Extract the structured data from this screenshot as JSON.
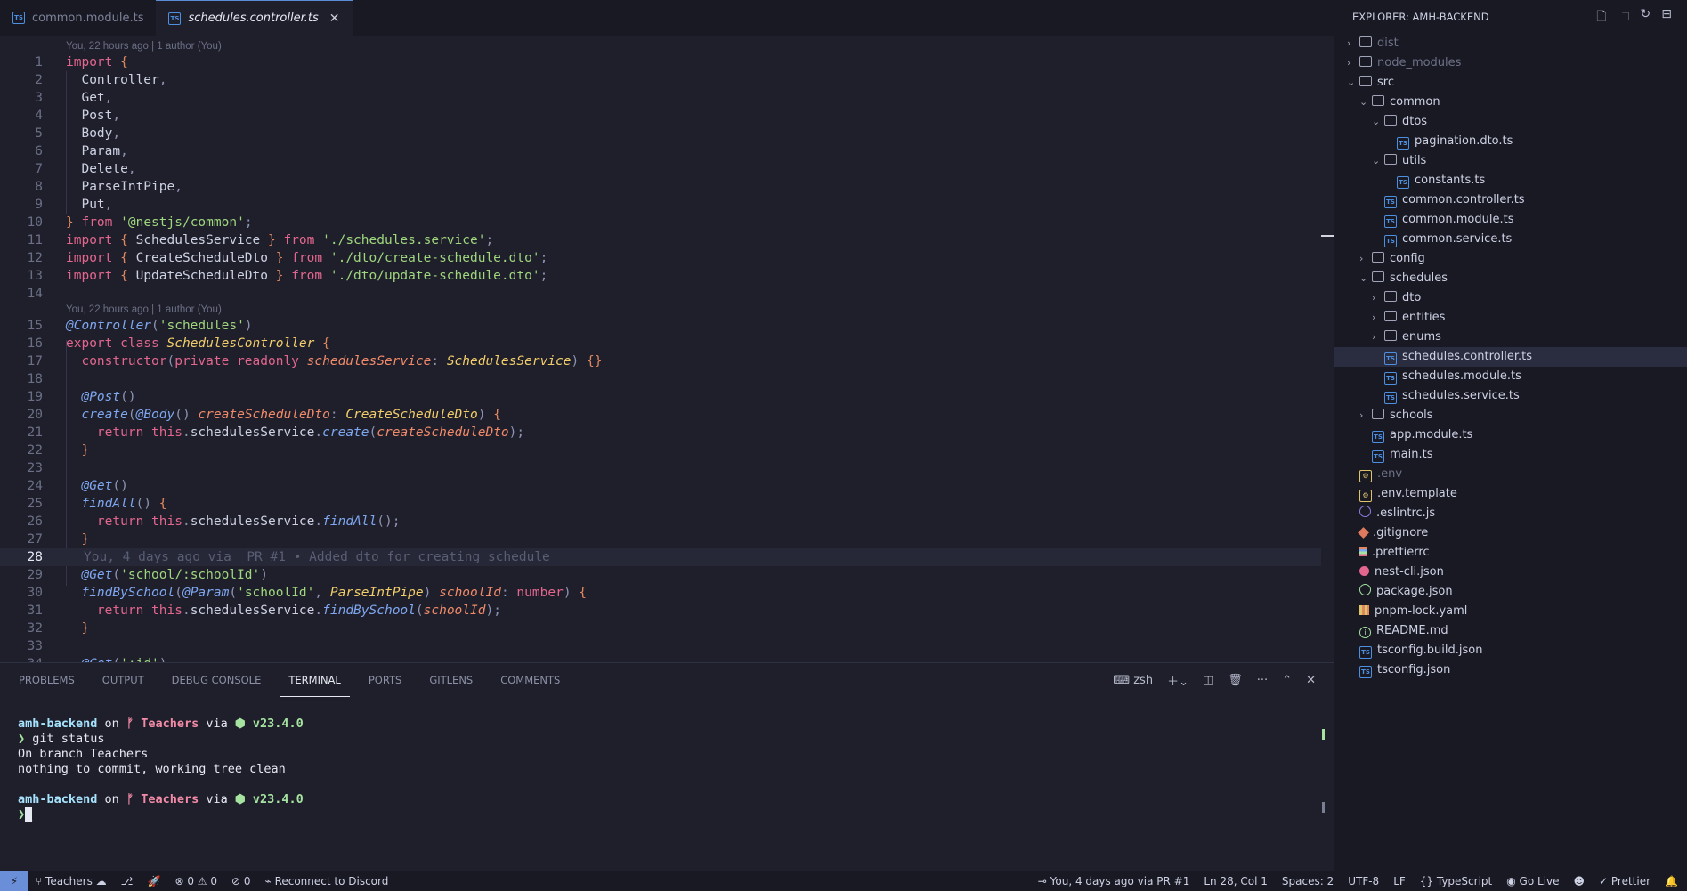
{
  "tabs": [
    {
      "label": "common.module.ts",
      "active": false
    },
    {
      "label": "schedules.controller.ts",
      "active": true
    }
  ],
  "tab_more": "···",
  "editor": {
    "blame_top": "You, 22 hours ago | 1 author (You)",
    "blame_class": "You, 22 hours ago | 1 author (You)",
    "inline_blame": "You, 4 days ago via  PR #1 • Added dto for creating schedule",
    "line_numbers": [
      "1",
      "2",
      "3",
      "4",
      "5",
      "6",
      "7",
      "8",
      "9",
      "10",
      "11",
      "12",
      "13",
      "14",
      "15",
      "16",
      "17",
      "18",
      "19",
      "20",
      "21",
      "22",
      "23",
      "24",
      "25",
      "26",
      "27",
      "28",
      "29",
      "30",
      "31",
      "32",
      "33",
      "34"
    ]
  },
  "panel": {
    "tabs": [
      "PROBLEMS",
      "OUTPUT",
      "DEBUG CONSOLE",
      "TERMINAL",
      "PORTS",
      "GITLENS",
      "COMMENTS"
    ],
    "active_tab": "TERMINAL",
    "shell": "zsh",
    "terminal": {
      "dir": "amh-backend",
      "on": "on",
      "branch_icon": "ᚠ",
      "branch": "Teachers",
      "via": "via",
      "node": "⬢ v23.4.0",
      "prompt": "❯",
      "cmd": "git status",
      "out1": "On branch Teachers",
      "out2": "nothing to commit, working tree clean"
    }
  },
  "explorer": {
    "title": "EXPLORER: AMH-BACKEND",
    "items": [
      {
        "label": "dist",
        "depth": 0,
        "kind": "folder",
        "open": false,
        "dim": true
      },
      {
        "label": "node_modules",
        "depth": 0,
        "kind": "folder",
        "open": false,
        "dim": true
      },
      {
        "label": "src",
        "depth": 0,
        "kind": "folder",
        "open": true
      },
      {
        "label": "common",
        "depth": 1,
        "kind": "folder",
        "open": true
      },
      {
        "label": "dtos",
        "depth": 2,
        "kind": "folder",
        "open": true
      },
      {
        "label": "pagination.dto.ts",
        "depth": 3,
        "kind": "ts"
      },
      {
        "label": "utils",
        "depth": 2,
        "kind": "folder",
        "open": true
      },
      {
        "label": "constants.ts",
        "depth": 3,
        "kind": "ts"
      },
      {
        "label": "common.controller.ts",
        "depth": 2,
        "kind": "ts"
      },
      {
        "label": "common.module.ts",
        "depth": 2,
        "kind": "ts"
      },
      {
        "label": "common.service.ts",
        "depth": 2,
        "kind": "ts"
      },
      {
        "label": "config",
        "depth": 1,
        "kind": "folder",
        "open": false
      },
      {
        "label": "schedules",
        "depth": 1,
        "kind": "folder",
        "open": true
      },
      {
        "label": "dto",
        "depth": 2,
        "kind": "folder",
        "open": false
      },
      {
        "label": "entities",
        "depth": 2,
        "kind": "folder",
        "open": false
      },
      {
        "label": "enums",
        "depth": 2,
        "kind": "folder",
        "open": false
      },
      {
        "label": "schedules.controller.ts",
        "depth": 2,
        "kind": "ts",
        "selected": true
      },
      {
        "label": "schedules.module.ts",
        "depth": 2,
        "kind": "ts"
      },
      {
        "label": "schedules.service.ts",
        "depth": 2,
        "kind": "ts"
      },
      {
        "label": "schools",
        "depth": 1,
        "kind": "folder",
        "open": false
      },
      {
        "label": "app.module.ts",
        "depth": 1,
        "kind": "ts"
      },
      {
        "label": "main.ts",
        "depth": 1,
        "kind": "ts"
      },
      {
        "label": ".env",
        "depth": 0,
        "kind": "env",
        "dim": true
      },
      {
        "label": ".env.template",
        "depth": 0,
        "kind": "env"
      },
      {
        "label": ".eslintrc.js",
        "depth": 0,
        "kind": "circ"
      },
      {
        "label": ".gitignore",
        "depth": 0,
        "kind": "git"
      },
      {
        "label": ".prettierrc",
        "depth": 0,
        "kind": "pret"
      },
      {
        "label": "nest-cli.json",
        "depth": 0,
        "kind": "nest"
      },
      {
        "label": "package.json",
        "depth": 0,
        "kind": "pkg"
      },
      {
        "label": "pnpm-lock.yaml",
        "depth": 0,
        "kind": "yaml"
      },
      {
        "label": "README.md",
        "depth": 0,
        "kind": "info"
      },
      {
        "label": "tsconfig.build.json",
        "depth": 0,
        "kind": "ts"
      },
      {
        "label": "tsconfig.json",
        "depth": 0,
        "kind": "ts"
      }
    ]
  },
  "status": {
    "remote": "⚡",
    "branch": "Teachers",
    "problems": "⊗ 0 ⚠ 0",
    "ports": "⊘ 0",
    "discord": "Reconnect to Discord",
    "blame": "You, 4 days ago via PR #1",
    "position": "Ln 28, Col 1",
    "spaces": "Spaces: 2",
    "encoding": "UTF-8",
    "eol": "LF",
    "language": "{} TypeScript",
    "golive": "Go Live",
    "prettier": "✓ Prettier"
  }
}
